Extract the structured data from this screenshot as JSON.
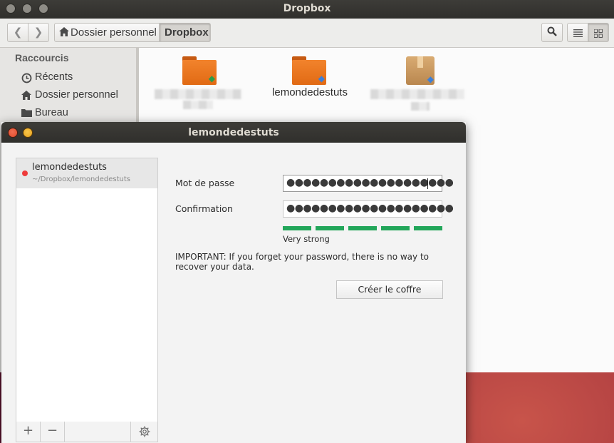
{
  "nautilus": {
    "title": "Dropbox",
    "breadcrumb": {
      "home": "Dossier personnel",
      "current": "Dropbox"
    },
    "sidebar": {
      "heading": "Raccourcis",
      "items": [
        {
          "label": "Récents",
          "icon": "clock-icon"
        },
        {
          "label": "Dossier personnel",
          "icon": "home-icon"
        },
        {
          "label": "Bureau",
          "icon": "folder-icon"
        }
      ]
    },
    "files": [
      {
        "label": "",
        "icon": "folder-icon",
        "badge": "sync-ok"
      },
      {
        "label": "lemondedestuts",
        "icon": "folder-icon",
        "badge": "syncing"
      },
      {
        "label": "",
        "icon": "package-icon",
        "badge": "syncing"
      }
    ]
  },
  "dialog": {
    "title": "lemondedestuts",
    "vault": {
      "name": "lemondedestuts",
      "path": "~/Dropbox/lemondedestuts",
      "status_color": "#ee3b3b"
    },
    "password_label": "Mot de passe",
    "password_value": "●●●●●●●●●●●●●●●●●●●●",
    "confirmation_label": "Confirmation",
    "confirmation_value": "●●●●●●●●●●●●●●●●●●●●",
    "strength": {
      "label": "Very strong",
      "segments_filled": 5,
      "segments_total": 5,
      "color": "#22a65a"
    },
    "warning": "IMPORTANT: If you forget your password, there is no way to recover your data.",
    "create_button": "Créer le coffre",
    "toolbar": {
      "add": "+",
      "remove": "−",
      "settings_icon": "gear-icon"
    }
  }
}
